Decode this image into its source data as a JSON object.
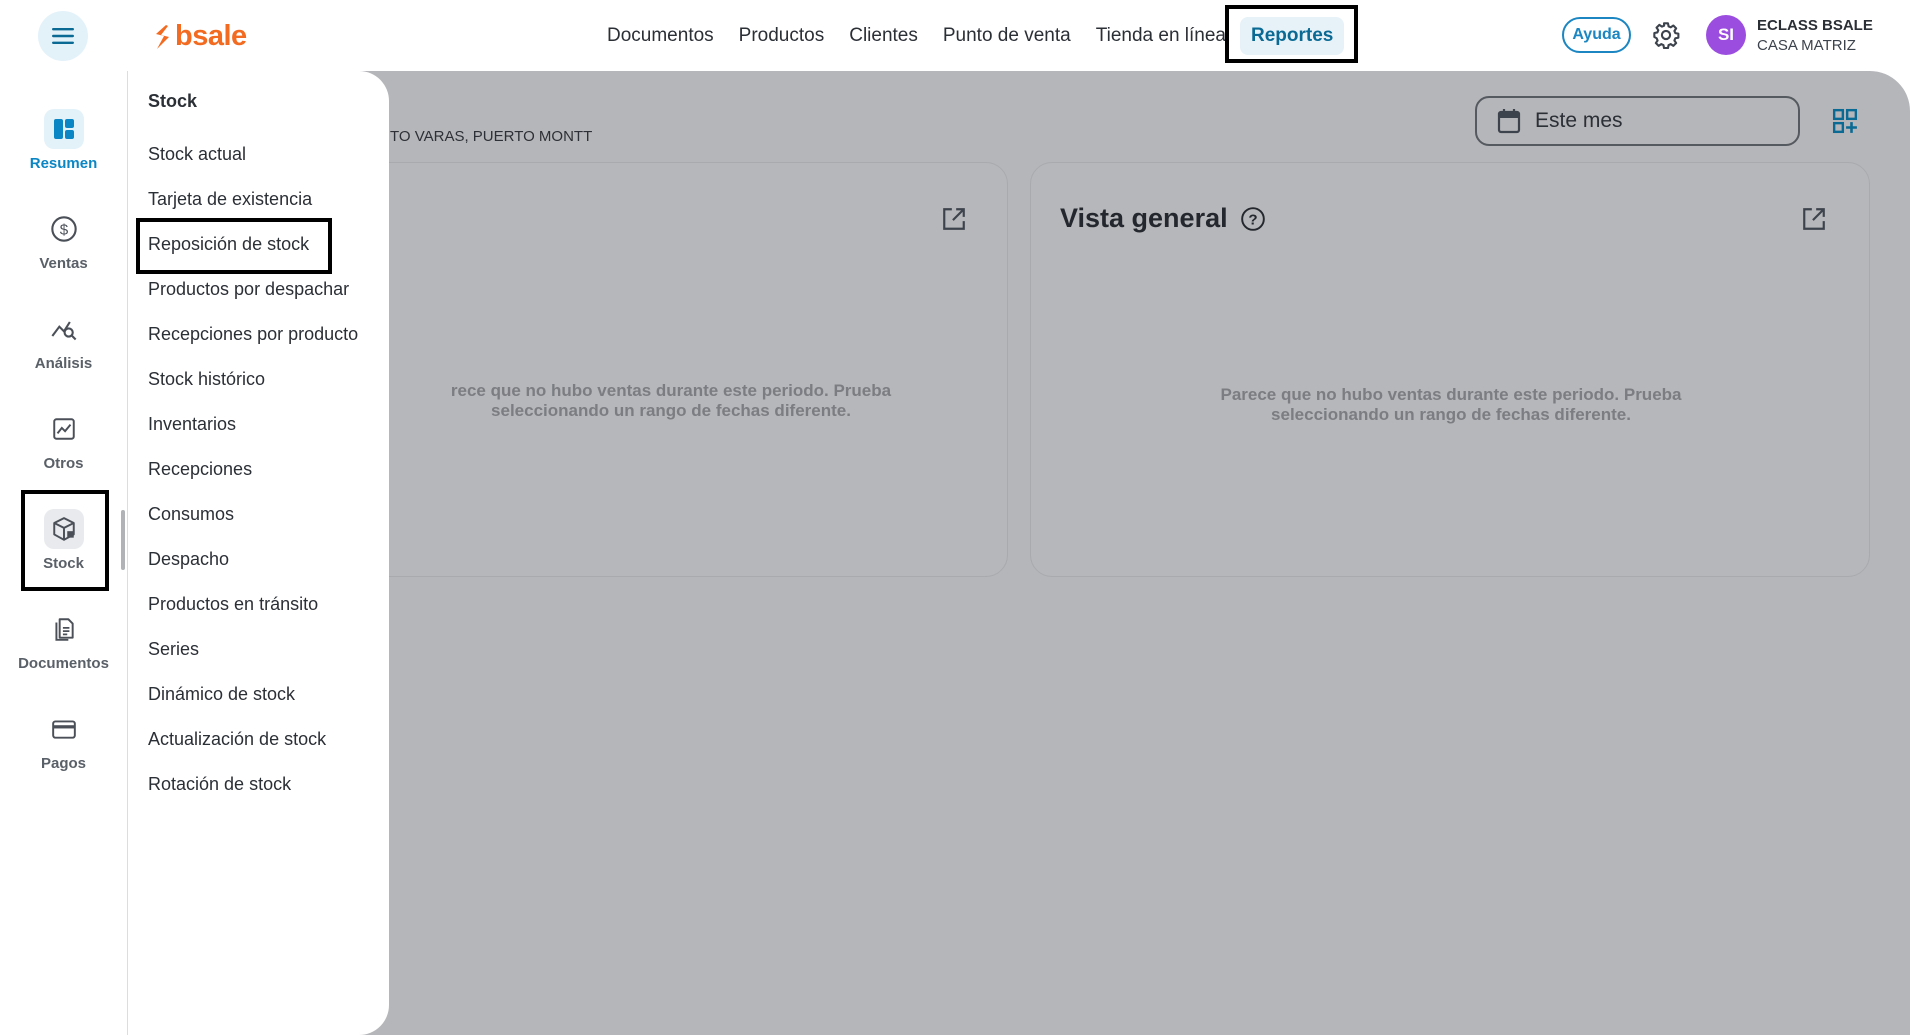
{
  "topbar": {
    "logo_text": "bsale",
    "nav": [
      "Documentos",
      "Productos",
      "Clientes",
      "Punto de venta",
      "Tienda en línea"
    ],
    "nav_active": "Reportes",
    "help_label": "Ayuda",
    "avatar_initials": "SI",
    "user_name": "ECLASS BSALE",
    "user_branch": "CASA MATRIZ"
  },
  "sidebar": {
    "items": [
      {
        "label": "Resumen",
        "icon": "dashboard-icon"
      },
      {
        "label": "Ventas",
        "icon": "dollar-circle-icon"
      },
      {
        "label": "Análisis",
        "icon": "analysis-icon"
      },
      {
        "label": "Otros",
        "icon": "chart-box-icon"
      },
      {
        "label": "Stock",
        "icon": "box-icon"
      },
      {
        "label": "Documentos",
        "icon": "documents-icon"
      },
      {
        "label": "Pagos",
        "icon": "credit-card-icon"
      }
    ]
  },
  "panel": {
    "title": "Stock",
    "items": [
      "Stock actual",
      "Tarjeta de existencia",
      "Reposición de stock",
      "Productos por despachar",
      "Recepciones por producto",
      "Stock histórico",
      "Inventarios",
      "Recepciones",
      "Consumos",
      "Despacho",
      "Productos en tránsito",
      "Series",
      "Dinámico de stock",
      "Actualización de stock",
      "Rotación de stock"
    ]
  },
  "content": {
    "location": "TO VARAS, PUERTO MONTT",
    "date_filter": "Este mes",
    "card1": {
      "empty_line1": "rece que no hubo ventas durante este periodo. Prueba",
      "empty_line2": "seleccionando un rango de fechas diferente."
    },
    "card2": {
      "title": "Vista general",
      "empty_line1": "Parece que no hubo ventas durante este periodo. Prueba",
      "empty_line2": "seleccionando un rango de fechas diferente."
    }
  },
  "colors": {
    "brand_orange": "#f26b21",
    "accent_blue": "#0b86c4",
    "avatar_purple": "#9b4de0",
    "overlay_gray": "#b5b6b9"
  }
}
